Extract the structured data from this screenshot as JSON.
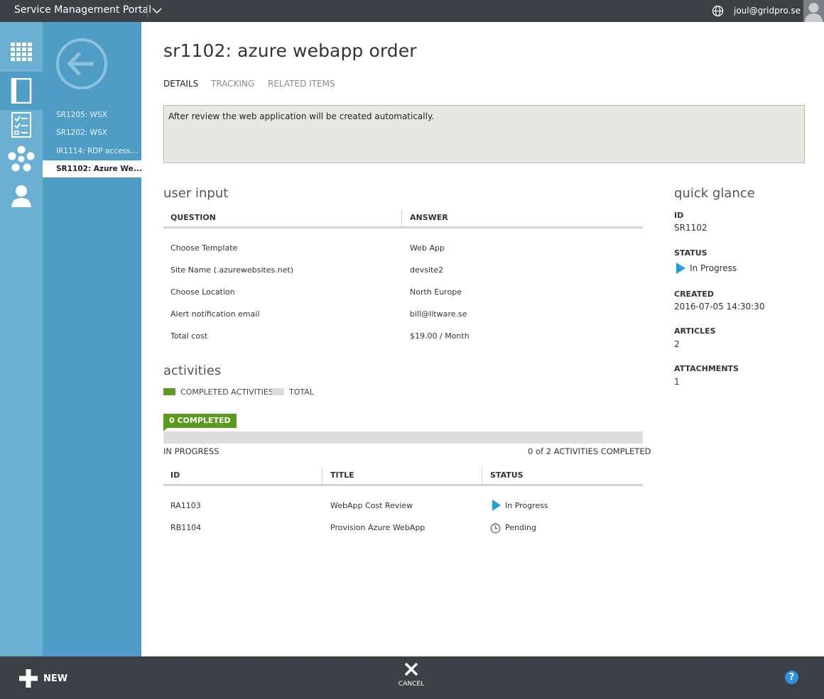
{
  "topbar": {
    "app_title": "Service Management Portal",
    "user": "joul@gridpro.se"
  },
  "rail": {
    "items": [
      {
        "icon": "grid-icon",
        "active": false
      },
      {
        "icon": "book-icon",
        "active": true
      },
      {
        "icon": "checklist-icon",
        "active": false
      },
      {
        "icon": "network-icon",
        "active": false
      },
      {
        "icon": "person-icon",
        "active": false
      }
    ]
  },
  "nav2": {
    "items": [
      {
        "label": "SR1205: WSX",
        "selected": false
      },
      {
        "label": "SR1202: WSX",
        "selected": false
      },
      {
        "label": "IR1114: RDP access...",
        "selected": false
      },
      {
        "label": "SR1102: Azure We...",
        "selected": true
      }
    ]
  },
  "page": {
    "title": "sr1102: azure webapp order",
    "tabs": [
      {
        "label": "DETAILS",
        "active": true
      },
      {
        "label": "TRACKING",
        "active": false
      },
      {
        "label": "RELATED ITEMS",
        "active": false
      }
    ],
    "description": "After review the web application will be created automatically."
  },
  "user_input": {
    "heading": "user input",
    "columns": [
      "QUESTION",
      "ANSWER"
    ],
    "rows": [
      [
        "Choose Template",
        "Web App"
      ],
      [
        "Site Name (.azurewebsites.net)",
        "devsite2"
      ],
      [
        "Choose Location",
        "North Europe"
      ],
      [
        "Alert notification email",
        "bill@litware.se"
      ],
      [
        "Total cost",
        "$19.00 / Month"
      ]
    ]
  },
  "activities": {
    "heading": "activities",
    "legend": [
      {
        "label": "COMPLETED ACTIVITIES",
        "color": "#5a9a1e"
      },
      {
        "label": "TOTAL",
        "color": "#dcdcdc"
      }
    ],
    "badge": "0 COMPLETED",
    "progress_fraction": 0,
    "state_label": "IN PROGRESS",
    "summary": "0 of 2 ACTIVITIES COMPLETED",
    "columns": [
      "ID",
      "TITLE",
      "STATUS"
    ],
    "rows": [
      {
        "id": "RA1103",
        "title": "WebApp Cost Review",
        "status": "In Progress",
        "status_icon": "play-icon"
      },
      {
        "id": "RB1104",
        "title": "Provision Azure WebApp",
        "status": "Pending",
        "status_icon": "clock-icon"
      }
    ]
  },
  "quick_glance": {
    "heading": "quick glance",
    "fields": [
      {
        "label": "ID",
        "value": "SR1102"
      },
      {
        "label": "STATUS",
        "value": "In Progress"
      },
      {
        "label": "CREATED",
        "value": "2016-07-05 14:30:30"
      },
      {
        "label": "ARTICLES",
        "value": "2"
      },
      {
        "label": "ATTACHMENTS",
        "value": "1"
      }
    ]
  },
  "bottombar": {
    "new_label": "NEW",
    "cancel_label": "CANCEL",
    "help_label": "?"
  },
  "colors": {
    "accent_blue": "#4f9cc4",
    "rail_blue": "#6bb0d3",
    "complete_green": "#5a9a1e",
    "chrome_dark": "#3c4047",
    "play_blue": "#1fa0dc"
  }
}
